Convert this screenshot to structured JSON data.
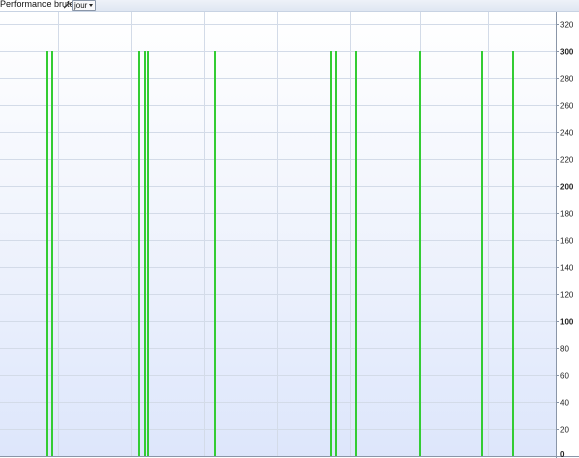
{
  "toolbar": {
    "title": "Performance brute",
    "wrench_icon": "wrench-icon",
    "period_value": "jour",
    "dropdown_icon": "chevron-down-icon"
  },
  "chart_data": {
    "type": "bar",
    "title": "",
    "xlabel": "",
    "ylabel": "",
    "ylim": [
      0,
      330
    ],
    "y_ticks": [
      {
        "value": 0,
        "label": "0",
        "bold": true
      },
      {
        "value": 20,
        "label": "20",
        "bold": false
      },
      {
        "value": 40,
        "label": "40",
        "bold": false
      },
      {
        "value": 60,
        "label": "60",
        "bold": false
      },
      {
        "value": 80,
        "label": "80",
        "bold": false
      },
      {
        "value": 100,
        "label": "100",
        "bold": true
      },
      {
        "value": 120,
        "label": "120",
        "bold": false
      },
      {
        "value": 140,
        "label": "140",
        "bold": false
      },
      {
        "value": 160,
        "label": "160",
        "bold": false
      },
      {
        "value": 180,
        "label": "180",
        "bold": false
      },
      {
        "value": 200,
        "label": "200",
        "bold": true
      },
      {
        "value": 220,
        "label": "220",
        "bold": false
      },
      {
        "value": 240,
        "label": "240",
        "bold": false
      },
      {
        "value": 260,
        "label": "260",
        "bold": false
      },
      {
        "value": 280,
        "label": "280",
        "bold": false
      },
      {
        "value": 300,
        "label": "300",
        "bold": true
      },
      {
        "value": 320,
        "label": "320",
        "bold": false
      }
    ],
    "series": [
      {
        "color": "#33cc33",
        "values": [
          300,
          300,
          300,
          300,
          300,
          300,
          300,
          300,
          300,
          300,
          300,
          300,
          300
        ]
      }
    ],
    "grid": true,
    "legend": "none"
  },
  "colors": {
    "bar": "#33cc33",
    "grid": "#d3dbe8",
    "axis": "#8a96a8"
  }
}
